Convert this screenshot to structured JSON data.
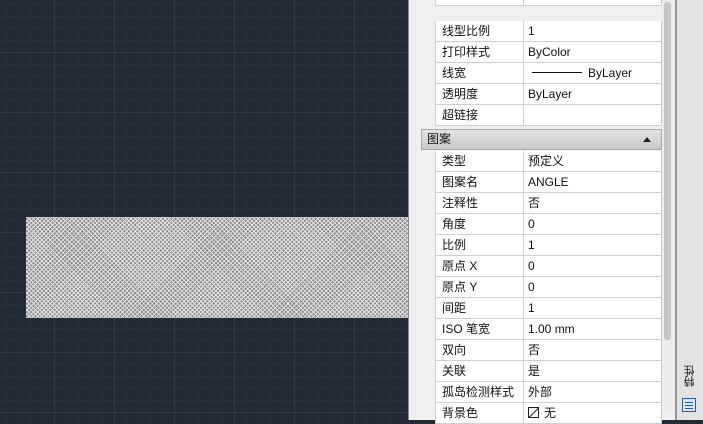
{
  "general": {
    "rows": [
      {
        "label": "线型比例",
        "value": "1"
      },
      {
        "label": "打印样式",
        "value": "ByColor"
      },
      {
        "label": "线宽",
        "value": "ByLayer"
      },
      {
        "label": "透明度",
        "value": "ByLayer"
      },
      {
        "label": "超链接",
        "value": ""
      }
    ]
  },
  "pattern": {
    "title": "图案",
    "rows": [
      {
        "label": "类型",
        "value": "预定义"
      },
      {
        "label": "图案名",
        "value": "ANGLE"
      },
      {
        "label": "注释性",
        "value": "否"
      },
      {
        "label": "角度",
        "value": "0"
      },
      {
        "label": "比例",
        "value": "1"
      },
      {
        "label": "原点 X",
        "value": "0"
      },
      {
        "label": "原点 Y",
        "value": "0"
      },
      {
        "label": "间距",
        "value": "1"
      },
      {
        "label": "ISO 笔宽",
        "value": "1.00 mm"
      },
      {
        "label": "双向",
        "value": "否"
      },
      {
        "label": "关联",
        "value": "是"
      },
      {
        "label": "孤岛检测样式",
        "value": "外部"
      },
      {
        "label": "背景色",
        "value": "无"
      }
    ]
  },
  "sidebar": {
    "tab_label": "特性"
  },
  "icons": {
    "collapse": "triangle-up-icon",
    "linewidth": "line-sample-icon",
    "background_none": "no-color-icon",
    "properties": "properties-icon"
  },
  "colors": {
    "canvas": "#222a35",
    "panel": "#f0f0f0",
    "section_header": "#d4d4d4"
  }
}
